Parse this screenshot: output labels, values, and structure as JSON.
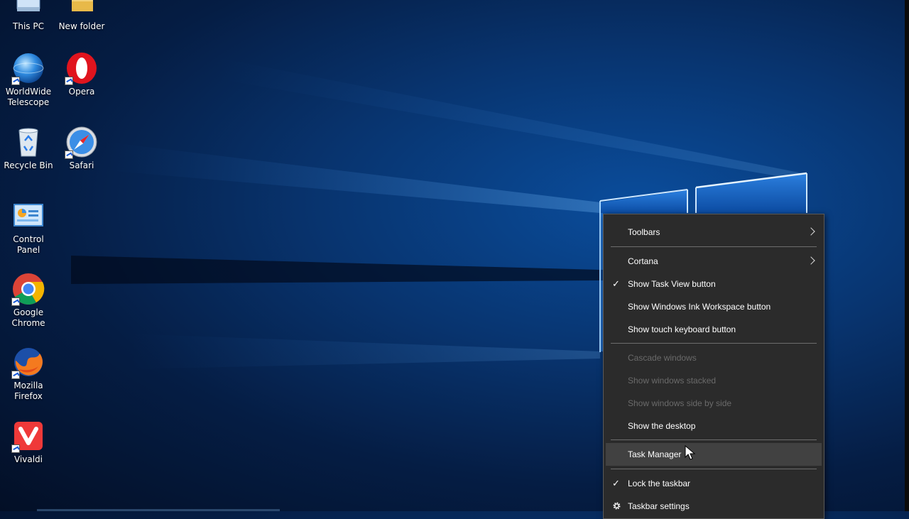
{
  "desktop": {
    "icons": [
      {
        "name": "this-pc",
        "label": "This PC",
        "icon": "computer-icon"
      },
      {
        "name": "new-folder",
        "label": "New folder",
        "icon": "folder-icon"
      },
      {
        "name": "worldwide-telescope",
        "label": "WorldWide Telescope",
        "icon": "globe-icon"
      },
      {
        "name": "opera",
        "label": "Opera",
        "icon": "opera-icon"
      },
      {
        "name": "recycle-bin",
        "label": "Recycle Bin",
        "icon": "recycle-bin-icon"
      },
      {
        "name": "safari",
        "label": "Safari",
        "icon": "compass-icon"
      },
      {
        "name": "control-panel",
        "label": "Control Panel",
        "icon": "control-panel-icon"
      },
      {
        "name": "google-chrome",
        "label": "Google Chrome",
        "icon": "chrome-icon"
      },
      {
        "name": "mozilla-firefox",
        "label": "Mozilla Firefox",
        "icon": "firefox-icon"
      },
      {
        "name": "vivaldi",
        "label": "Vivaldi",
        "icon": "vivaldi-icon"
      }
    ]
  },
  "context_menu": {
    "items": [
      {
        "label": "Toolbars",
        "checked": false,
        "enabled": true,
        "submenu": true
      },
      {
        "label": "Cortana",
        "checked": false,
        "enabled": true,
        "submenu": true
      },
      {
        "label": "Show Task View button",
        "checked": true,
        "enabled": true
      },
      {
        "label": "Show Windows Ink Workspace button",
        "checked": false,
        "enabled": true
      },
      {
        "label": "Show touch keyboard button",
        "checked": false,
        "enabled": true
      },
      {
        "label": "Cascade windows",
        "checked": false,
        "enabled": false
      },
      {
        "label": "Show windows stacked",
        "checked": false,
        "enabled": false
      },
      {
        "label": "Show windows side by side",
        "checked": false,
        "enabled": false
      },
      {
        "label": "Show the desktop",
        "checked": false,
        "enabled": true
      },
      {
        "label": "Task Manager",
        "checked": false,
        "enabled": true,
        "highlighted": true
      },
      {
        "label": "Lock the taskbar",
        "checked": true,
        "enabled": true
      },
      {
        "label": "Taskbar settings",
        "checked": false,
        "enabled": true,
        "icon": "gear-icon"
      }
    ],
    "check_glyph": "✓"
  },
  "colors": {
    "menu_bg": "#2b2b2b",
    "menu_hover": "#414141",
    "disabled_text": "#6a6a6a",
    "wallpaper_accent": "#1e90ff"
  }
}
